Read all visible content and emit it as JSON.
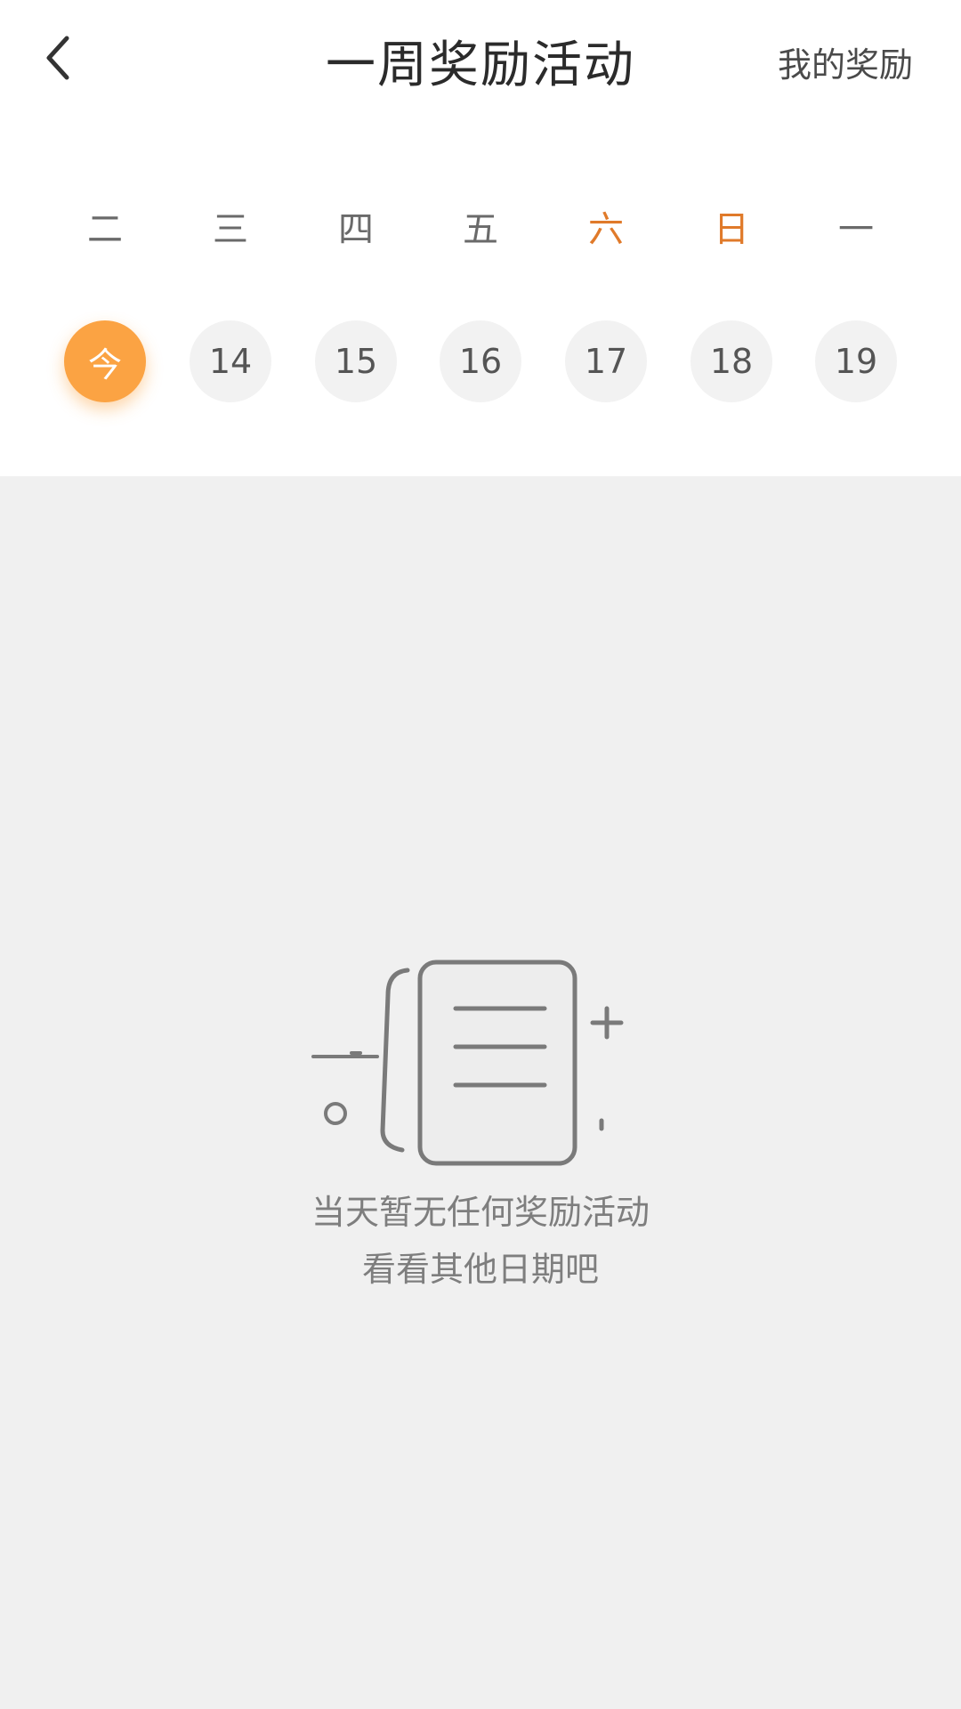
{
  "header": {
    "title": "一周奖励活动",
    "my_rewards": "我的奖励",
    "back_icon": "chevron-left-icon"
  },
  "week": {
    "weekdays": [
      {
        "label": "二",
        "weekend": false
      },
      {
        "label": "三",
        "weekend": false
      },
      {
        "label": "四",
        "weekend": false
      },
      {
        "label": "五",
        "weekend": false
      },
      {
        "label": "六",
        "weekend": true
      },
      {
        "label": "日",
        "weekend": true
      },
      {
        "label": "一",
        "weekend": false
      }
    ],
    "dates": [
      {
        "label": "今",
        "selected": true
      },
      {
        "label": "14",
        "selected": false
      },
      {
        "label": "15",
        "selected": false
      },
      {
        "label": "16",
        "selected": false
      },
      {
        "label": "17",
        "selected": false
      },
      {
        "label": "18",
        "selected": false
      },
      {
        "label": "19",
        "selected": false
      }
    ]
  },
  "empty_state": {
    "icon": "document-icon",
    "line1": "当天暂无任何奖励活动",
    "line2": "看看其他日期吧"
  },
  "colors": {
    "accent": "#fba343",
    "weekend": "#e07a2a",
    "background": "#f0f0f0"
  }
}
